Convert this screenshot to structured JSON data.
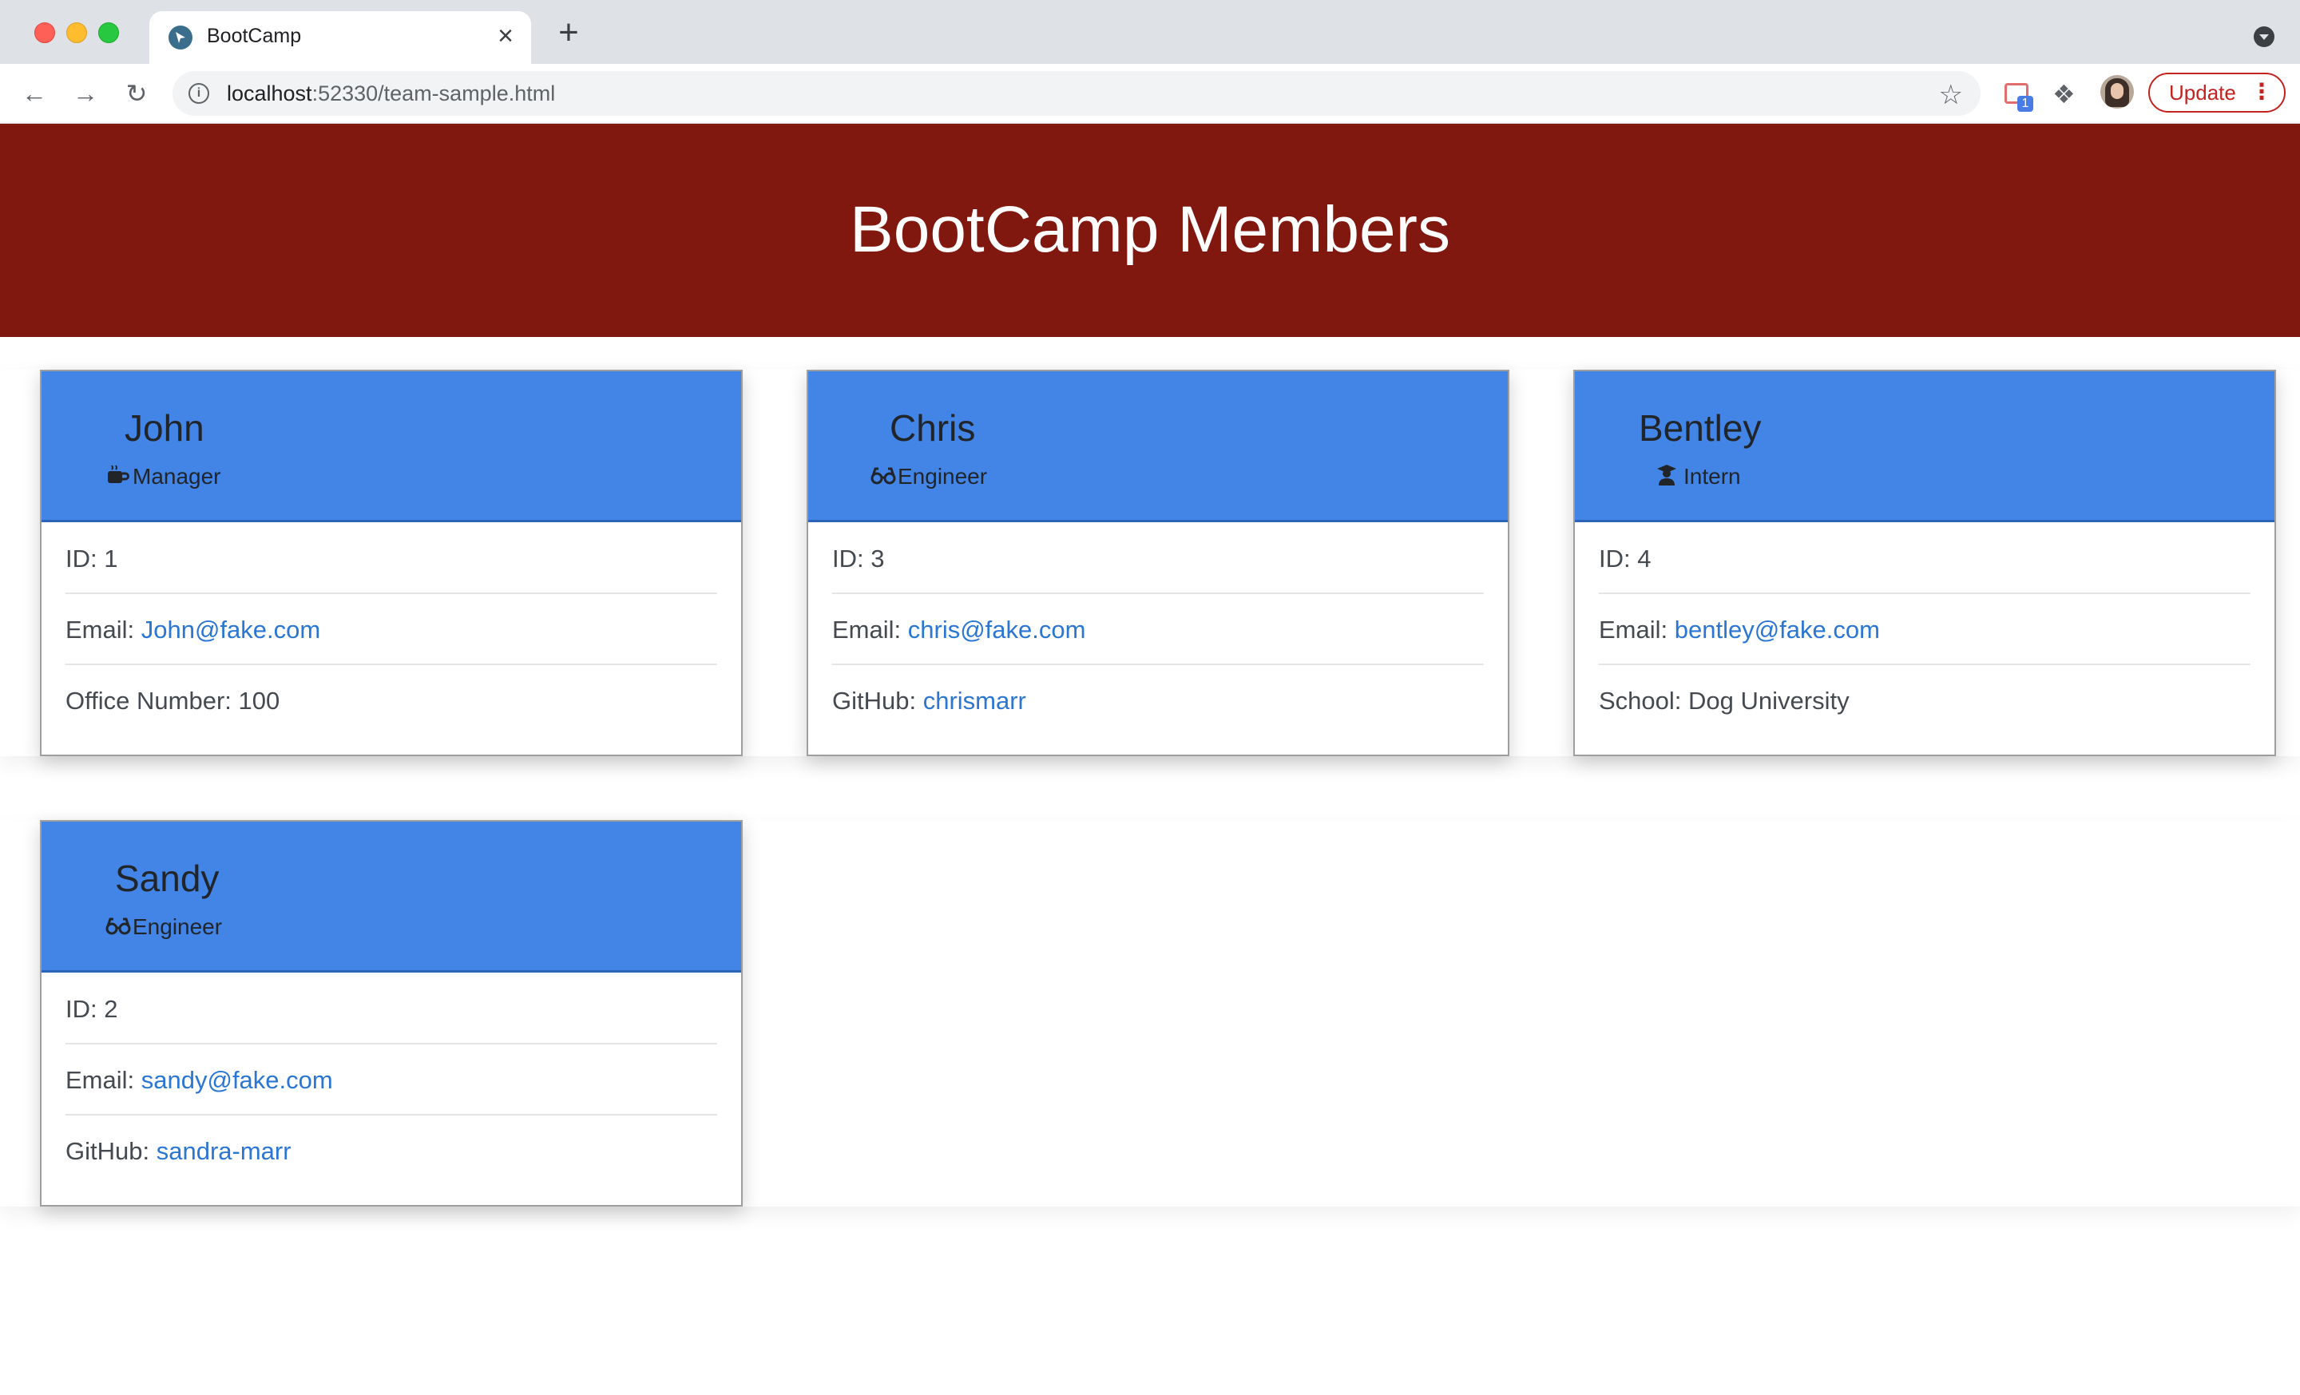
{
  "browser": {
    "tab_title": "BootCamp",
    "tab_close": "×",
    "new_tab": "+",
    "url_host": "localhost",
    "url_path": ":52330/team-sample.html",
    "update_label": "Update",
    "extension_badge": "1"
  },
  "page": {
    "title": "BootCamp Members"
  },
  "members": [
    {
      "name": "John",
      "role": "Manager",
      "role_icon": "coffee-icon",
      "id_label": "ID: 1",
      "email_label": "Email: ",
      "email": "John@fake.com",
      "extra_label": "Office Number: 100",
      "extra_link": ""
    },
    {
      "name": "Chris",
      "role": "Engineer",
      "role_icon": "glasses-icon",
      "id_label": "ID: 3",
      "email_label": "Email: ",
      "email": "chris@fake.com",
      "extra_label": "GitHub: ",
      "extra_link": "chrismarr"
    },
    {
      "name": "Bentley",
      "role": "Intern",
      "role_icon": "graduate-icon",
      "id_label": "ID: 4",
      "email_label": "Email: ",
      "email": "bentley@fake.com",
      "extra_label": "School: Dog University",
      "extra_link": ""
    },
    {
      "name": "Sandy",
      "role": "Engineer",
      "role_icon": "glasses-icon",
      "id_label": "ID: 2",
      "email_label": "Email: ",
      "email": "sandy@fake.com",
      "extra_label": "GitHub: ",
      "extra_link": "sandra-marr"
    }
  ],
  "colors": {
    "header_bg": "#801810",
    "card_header_bg": "#4285e6",
    "link": "#2a76d2"
  }
}
